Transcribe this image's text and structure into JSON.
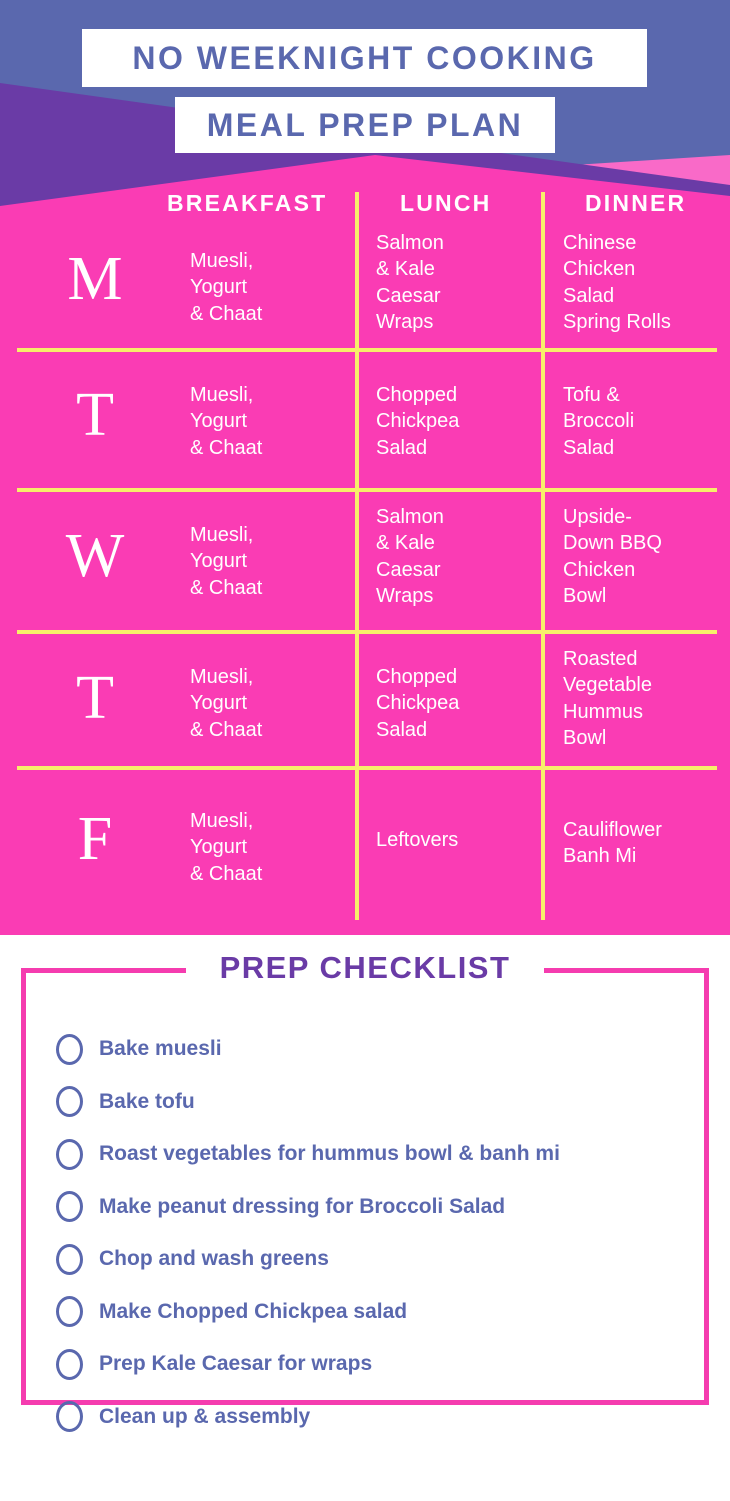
{
  "header": {
    "title_line1": "NO WEEKNIGHT COOKING",
    "title_line2": "MEAL PREP PLAN",
    "colors": {
      "blue": "#5A68AE",
      "purple": "#6A3BA6",
      "pink": "#FA3CB4",
      "light_pink": "#F96AC8",
      "yellow": "#F7EF6A",
      "white": "#FFFFFF"
    }
  },
  "table": {
    "columns": [
      "BREAKFAST",
      "LUNCH",
      "DINNER"
    ],
    "rows": [
      {
        "day": "M",
        "breakfast": "Muesli,\nYogurt\n& Chaat",
        "lunch": "Salmon\n& Kale\nCaesar\nWraps",
        "dinner": "Chinese\nChicken\nSalad\nSpring Rolls"
      },
      {
        "day": "T",
        "breakfast": "Muesli,\nYogurt\n& Chaat",
        "lunch": "Chopped\nChickpea\nSalad",
        "dinner": "Tofu &\nBroccoli\nSalad"
      },
      {
        "day": "W",
        "breakfast": "Muesli,\nYogurt\n& Chaat",
        "lunch": "Salmon\n& Kale\nCaesar\nWraps",
        "dinner": "Upside-\nDown BBQ\nChicken\nBowl"
      },
      {
        "day": "T",
        "breakfast": "Muesli,\nYogurt\n& Chaat",
        "lunch": "Chopped\nChickpea\nSalad",
        "dinner": "Roasted\nVegetable\nHummus\nBowl"
      },
      {
        "day": "F",
        "breakfast": "Muesli,\nYogurt\n& Chaat",
        "lunch": "Leftovers",
        "dinner": "Cauliflower\nBanh Mi"
      }
    ]
  },
  "checklist": {
    "title": "PREP CHECKLIST",
    "items": [
      {
        "label": "Bake muesli",
        "checked": false
      },
      {
        "label": "Bake tofu",
        "checked": false
      },
      {
        "label": "Roast vegetables for hummus bowl & banh mi",
        "checked": false
      },
      {
        "label": "Make peanut dressing for Broccoli Salad",
        "checked": false
      },
      {
        "label": "Chop and wash greens",
        "checked": false
      },
      {
        "label": "Make Chopped Chickpea salad",
        "checked": false
      },
      {
        "label": "Prep Kale Caesar for wraps",
        "checked": false
      },
      {
        "label": "Clean up & assembly",
        "checked": false
      }
    ]
  }
}
